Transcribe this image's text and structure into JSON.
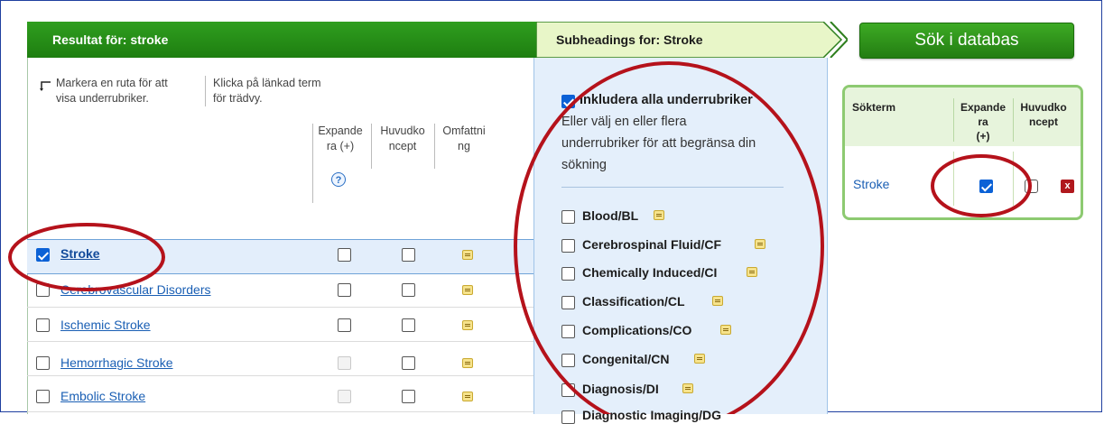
{
  "results": {
    "title": "Resultat för: stroke",
    "instruction_left": [
      "Markera en ruta för att",
      "visa underrubriker."
    ],
    "instruction_right": [
      "Klicka på länkad term",
      "för trädvy."
    ],
    "col_expand": [
      "Expande",
      "ra (+)"
    ],
    "col_major": [
      "Huvudko",
      "ncept"
    ],
    "col_scope": [
      "Omfattni",
      "ng"
    ],
    "help": "?",
    "rows": [
      {
        "term": "Stroke",
        "checked": true
      },
      {
        "term": "Cerebrovascular Disorders",
        "checked": false
      },
      {
        "term": "Ischemic Stroke",
        "checked": false
      },
      {
        "term": "Hemorrhagic Stroke",
        "checked": false
      },
      {
        "term": "Embolic Stroke",
        "checked": false
      }
    ]
  },
  "subheadings": {
    "title": "Subheadings for: Stroke",
    "include_all": "Inkludera alla underrubriker",
    "help_lines": [
      "Eller välj en eller flera",
      "underrubriker för att begränsa din",
      "sökning"
    ],
    "items": [
      "Blood/BL",
      "Cerebrospinal Fluid/CF",
      "Chemically Induced/CI",
      "Classification/CL",
      "Complications/CO",
      "Congenital/CN",
      "Diagnosis/DI",
      "Diagnostic Imaging/DG"
    ]
  },
  "search": {
    "button": "Sök i databas",
    "col_term": "Sökterm",
    "col_expand": [
      "Expande",
      "ra",
      "(+)"
    ],
    "col_major": [
      "Huvudko",
      "ncept"
    ],
    "term": "Stroke",
    "expand_checked": true,
    "major_checked": false,
    "delete": "x"
  },
  "colors": {
    "green": "#2f9e1f",
    "blue_link": "#1a5fb4",
    "annotation_red": "#b5121b"
  }
}
